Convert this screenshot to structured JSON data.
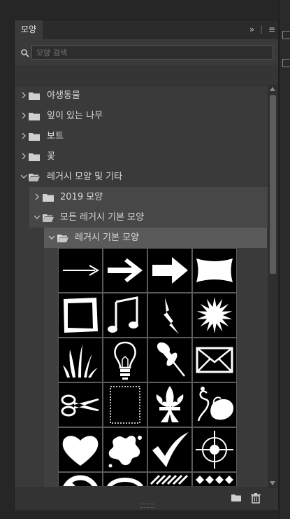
{
  "panel": {
    "tab_label": "모양",
    "expand_glyph": "»",
    "separator": "|",
    "menu_glyph": "≡"
  },
  "search": {
    "placeholder": "모양 검색",
    "value": ""
  },
  "tree": [
    {
      "label": "야생동물",
      "level": 0,
      "expanded": false
    },
    {
      "label": "잎이 있는 나무",
      "level": 0,
      "expanded": false
    },
    {
      "label": "보트",
      "level": 0,
      "expanded": false
    },
    {
      "label": "꽃",
      "level": 0,
      "expanded": false
    },
    {
      "label": "레거시 모양 및 기타",
      "level": 0,
      "expanded": true
    },
    {
      "label": "2019 모양",
      "level": 1,
      "expanded": false
    },
    {
      "label": "모든 레거시 기본 모양",
      "level": 1,
      "expanded": true
    },
    {
      "label": "레거시 기본 모양",
      "level": 2,
      "expanded": true,
      "selected": true
    }
  ],
  "shapes": [
    "arrow-thin",
    "arrow-bold",
    "arrow-block",
    "banner",
    "frame-rough",
    "music-notes",
    "lightning",
    "starburst",
    "grass",
    "lightbulb",
    "pushpin",
    "envelope",
    "scissors",
    "postage-stamp",
    "fleur-de-lis",
    "ornament-leaf",
    "heart",
    "splat",
    "checkmark",
    "target-crosshair",
    "no-symbol",
    "speech-bubble",
    "stripes-pattern",
    "diamond-pattern"
  ],
  "footer": {
    "new_group_icon": "folder-icon",
    "delete_icon": "trash-icon"
  },
  "colors": {
    "panel_bg": "#3a3a3a",
    "selected_row": "#5a5a5a",
    "shape_cell": "#000000",
    "shape_fill": "#ffffff"
  }
}
